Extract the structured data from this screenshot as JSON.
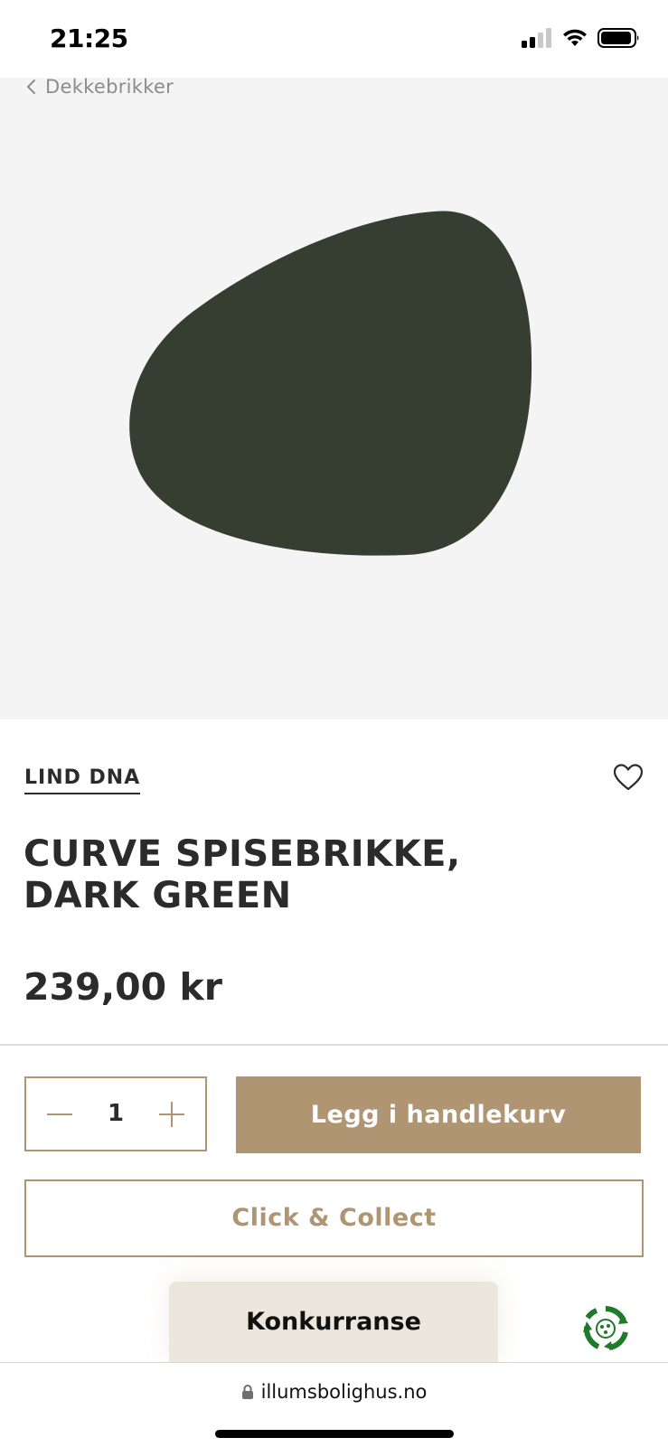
{
  "status_bar": {
    "time": "21:25",
    "icons": [
      "cellular-signal-icon",
      "wifi-icon",
      "battery-icon"
    ]
  },
  "breadcrumb": {
    "back_icon": "chevron-left-icon",
    "label": "Dekkebrikker"
  },
  "product": {
    "image_color": "#363d31",
    "brand": "LIND DNA",
    "title_line1": "CURVE SPISEBRIKKE,",
    "title_line2": "DARK GREEN",
    "price": "239,00 kr",
    "wishlist_icon": "heart-outline-icon"
  },
  "purchase": {
    "quantity": "1",
    "minus_icon": "minus-icon",
    "plus_icon": "plus-icon",
    "add_to_cart_label": "Legg i handlekurv",
    "click_collect_label": "Click & Collect",
    "contest_label": "Konkurranse",
    "recycle_icon": "recycle-badge-icon"
  },
  "browser": {
    "lock_icon": "lock-icon",
    "url": "illumsbolighus.no"
  },
  "colors": {
    "accent": "#b09573",
    "text": "#2b2b2b",
    "hero_background": "#f4f4f4",
    "contest_background": "#ede6dc"
  }
}
